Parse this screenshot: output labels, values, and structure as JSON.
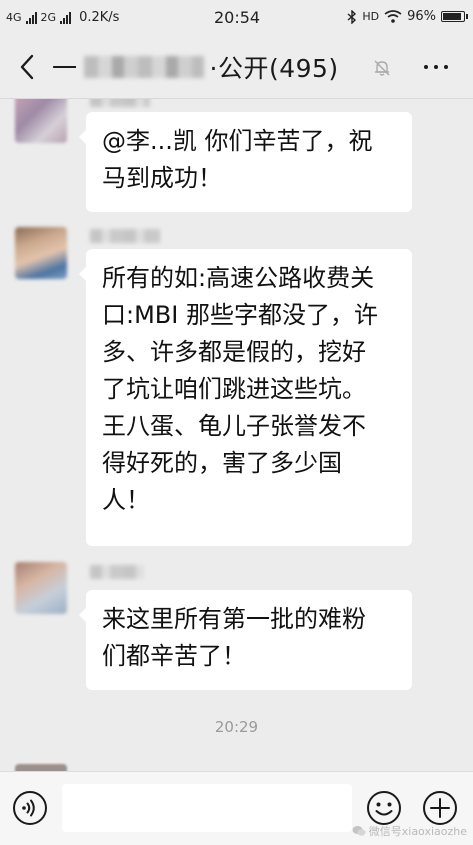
{
  "status_bar": {
    "net_1": "4G",
    "net_2": "2G",
    "speed": "0.2K/s",
    "time": "20:54",
    "hd": "HD",
    "battery": "96%",
    "battery_level": 0.96
  },
  "title_bar": {
    "title_prefix": "一",
    "title_suffix": "·公开(495)"
  },
  "messages": [
    {
      "lines": [
        "@李...凯  你们辛苦了，祝",
        "马到成功！"
      ]
    },
    {
      "lines": [
        "所有的如:高速公路收费关",
        "口:MBI 那些字都没了，许",
        "多、许多都是假的，挖好",
        "了坑让咱们跳进这些坑。",
        "王八蛋、龟儿子张誉发不",
        "得好死的，害了多少国",
        "人！"
      ]
    },
    {
      "lines": [
        "来这里所有第一批的难粉",
        "们都辛苦了！"
      ]
    }
  ],
  "time_divider": "20:29",
  "input": {
    "value": "",
    "placeholder": ""
  },
  "watermark": "微信号xiaoxiaozhe",
  "icons": {
    "back": "chevron-left-icon",
    "mute": "bell-off-icon",
    "more": "more-dots-icon",
    "voice": "voice-icon",
    "emoji": "emoji-icon",
    "plus": "plus-icon"
  }
}
